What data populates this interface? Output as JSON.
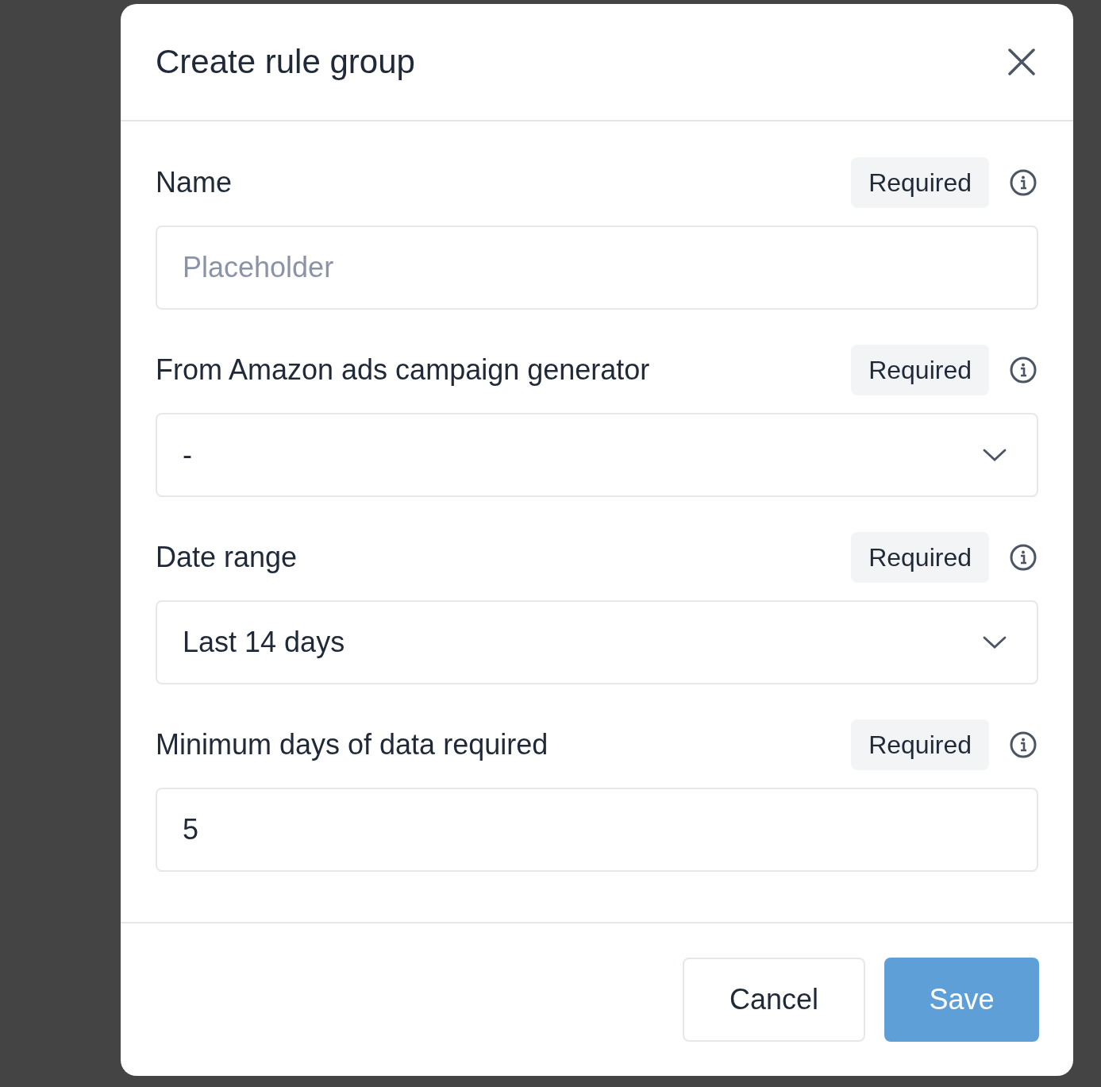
{
  "dialog": {
    "title": "Create rule group"
  },
  "fields": [
    {
      "kind": "text",
      "label": "Name",
      "badge": "Required",
      "placeholder": "Placeholder"
    },
    {
      "kind": "select",
      "label": "From Amazon ads campaign generator",
      "badge": "Required",
      "value": "-"
    },
    {
      "kind": "select",
      "label": "Date range",
      "badge": "Required",
      "value": "Last 14 days"
    },
    {
      "kind": "text",
      "label": "Minimum days of data required",
      "badge": "Required",
      "value": "5"
    }
  ],
  "buttons": [
    {
      "kind": "secondary",
      "label": "Cancel",
      "disabled": false
    },
    {
      "kind": "primary",
      "label": "Save",
      "disabled": true
    }
  ]
}
